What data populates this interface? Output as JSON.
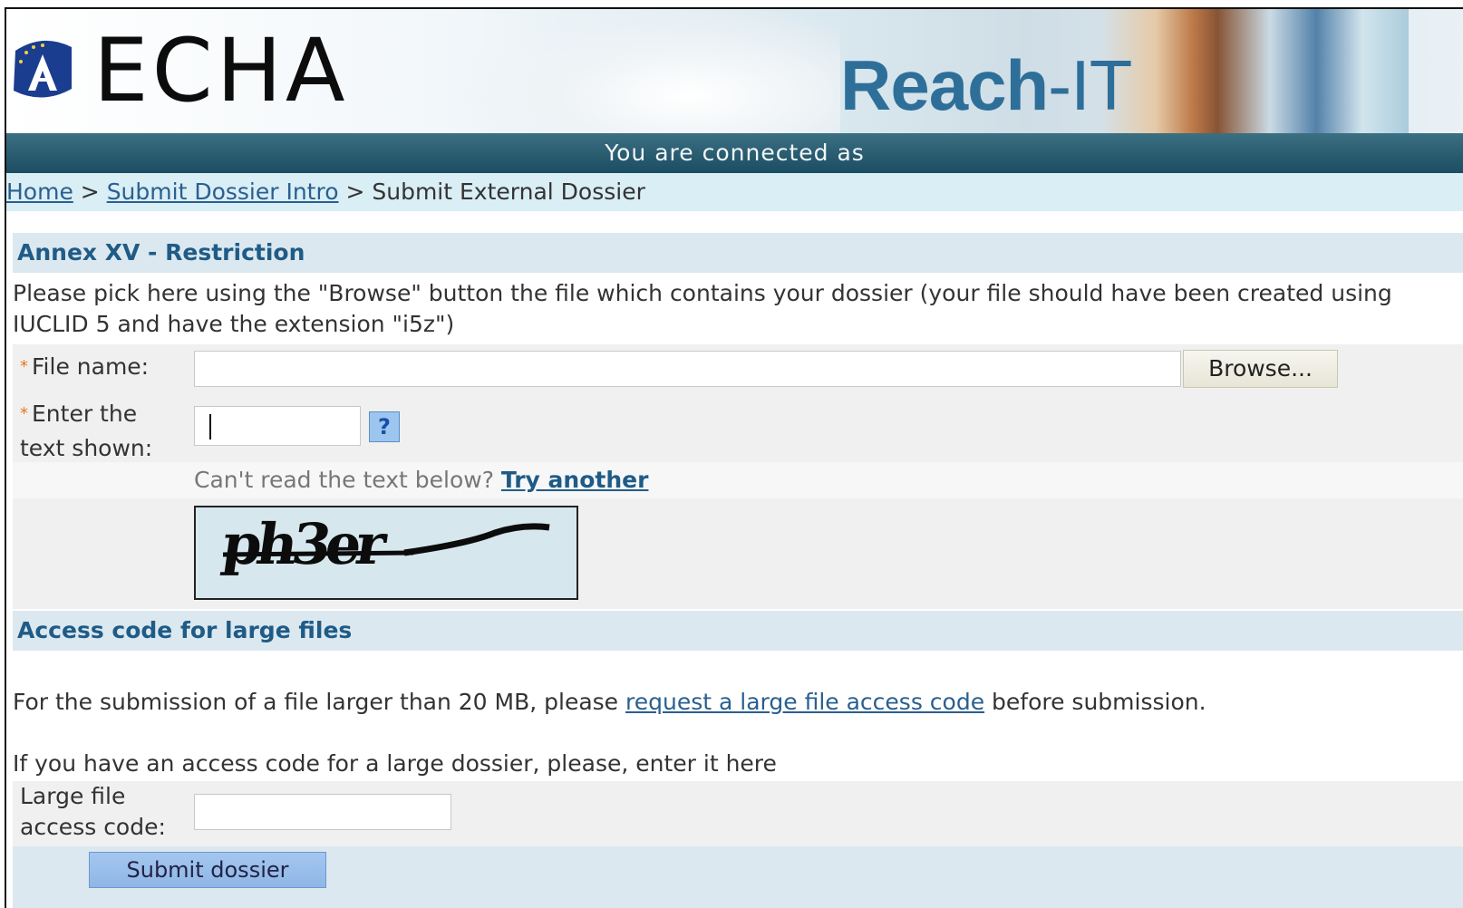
{
  "header": {
    "logo_text": "ECHA",
    "app_name": "Reach",
    "app_suffix": "-IT"
  },
  "status": {
    "text": "You are connected as"
  },
  "breadcrumb": {
    "home": "Home",
    "sep1": ">",
    "intro": "Submit Dossier Intro",
    "sep2": ">",
    "current": "Submit External Dossier"
  },
  "section1": {
    "title": "Annex XV - Restriction",
    "intro": "Please pick here using the \"Browse\" button the file which contains your dossier (your file should have been created using IUCLID 5 and have the extension \"i5z\")",
    "file_label": "File name:",
    "file_value": "",
    "browse_label": "Browse...",
    "captcha_label_line1": "Enter the",
    "captcha_label_line2": "text shown:",
    "captcha_value": "",
    "help_label": "?",
    "cant_read": "Can't read the text below?",
    "try_another": "Try another",
    "captcha_text": "ph3er"
  },
  "section2": {
    "title": "Access code for large files",
    "note_prefix": "For the submission of a file larger than 20 MB, please",
    "note_link": "request a large file access code",
    "note_suffix": "before submission.",
    "have_code": "If you have an access code for a large dossier, please, enter it here",
    "code_label_line1": "Large file",
    "code_label_line2": "access code:",
    "code_value": "",
    "submit_label": "Submit dossier"
  },
  "colors": {
    "accent": "#1f5b86",
    "status_bar": "#1c4d62",
    "breadcrumb_bg": "#d9eef5",
    "required_marker": "#e87722"
  }
}
